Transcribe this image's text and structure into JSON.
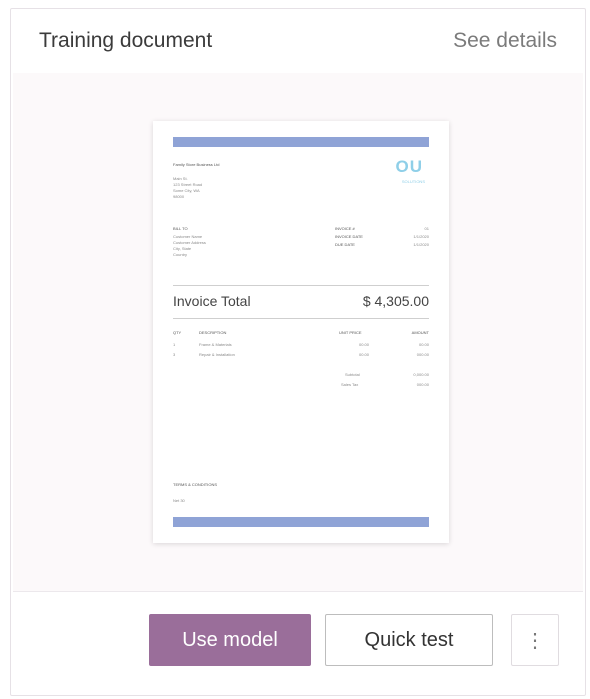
{
  "card": {
    "title": "Training document",
    "see_details_label": "See details"
  },
  "document": {
    "company_name": "Family Store Business Ltd",
    "logo_text": "OU",
    "logo_subtext": "SOLUTIONS",
    "address_lines": [
      "Main St.",
      "123 Street Road",
      "Some City, WA",
      "98000"
    ],
    "bill_to_label": "BILL TO",
    "bill_to_lines": [
      "Customer Name",
      "Customer Address",
      "City, State",
      "Country"
    ],
    "meta": [
      {
        "label": "INVOICE #",
        "value": "01"
      },
      {
        "label": "INVOICE DATE",
        "value": "1/1/2020"
      },
      {
        "label": "DUE DATE",
        "value": "1/1/2020"
      }
    ],
    "invoice_total_label": "Invoice Total",
    "invoice_total_value": "$ 4,305.00",
    "table_headers": [
      "QTY",
      "DESCRIPTION",
      "UNIT PRICE",
      "AMOUNT"
    ],
    "rows": [
      {
        "qty": "1",
        "description": "Frame & Materials",
        "unit_price": "00.00",
        "amount": "00.00"
      },
      {
        "qty": "3",
        "description": "Repair & Installation",
        "unit_price": "00.00",
        "amount": "000.00"
      }
    ],
    "summary": [
      {
        "label": "Subtotal",
        "value": "0,000.00"
      },
      {
        "label": "Sales Tax",
        "value": "000.00"
      }
    ],
    "terms_label": "TERMS & CONDITIONS",
    "terms_text": "Net 30"
  },
  "actions": {
    "use_model_label": "Use model",
    "quick_test_label": "Quick test",
    "more_label": "⋮"
  },
  "colors": {
    "accent": "#9a6e9a",
    "doc_bar": "#8fa3d6"
  }
}
